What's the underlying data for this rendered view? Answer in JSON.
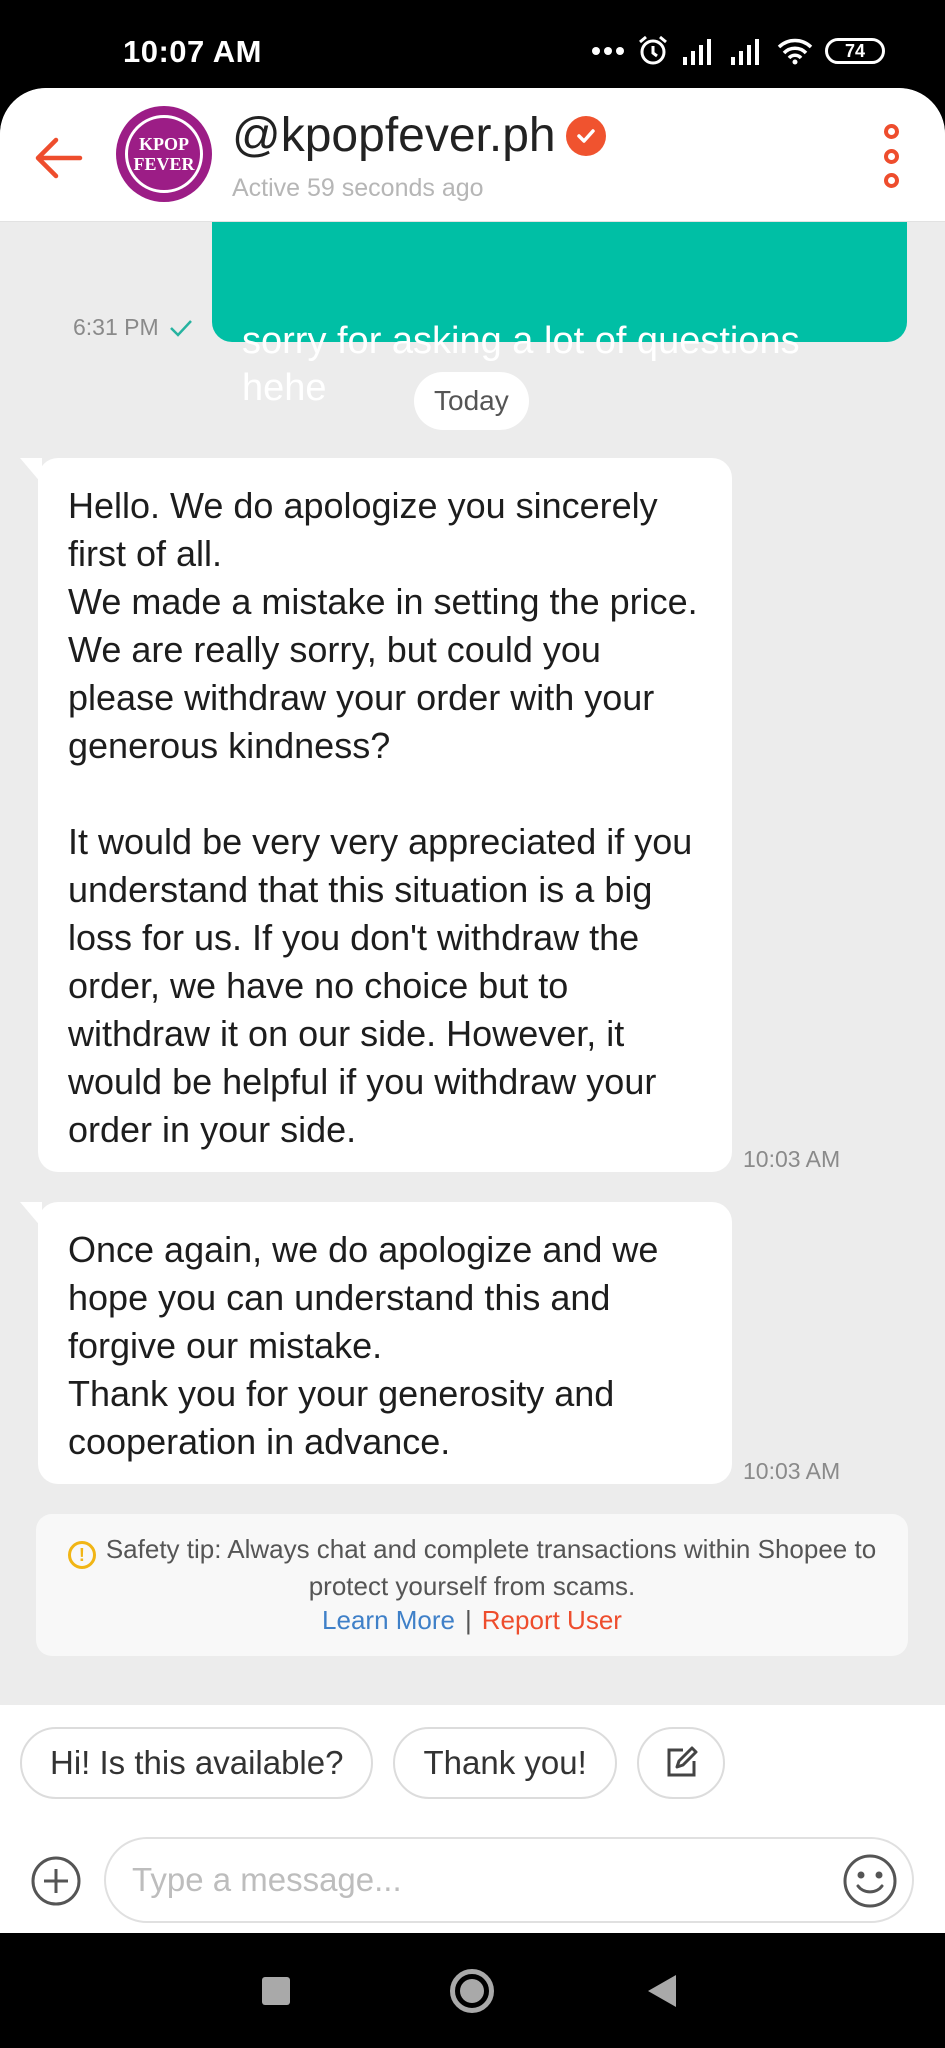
{
  "status_bar": {
    "time": "10:07 AM",
    "battery": "74"
  },
  "header": {
    "shop_name": "@kpopfever.ph",
    "active_status": "Active 59 seconds ago",
    "avatar_line1": "KPOP",
    "avatar_line2": "FEVER"
  },
  "messages": {
    "outgoing": {
      "text": "sorry for asking a lot of questions hehe",
      "time": "6:31 PM"
    },
    "date_divider": "Today",
    "incoming": [
      {
        "text": "Hello. We do apologize you sincerely first of all.\nWe made a mistake in setting the price. We are really sorry, but could you please withdraw your order with your generous kindness?\n\nIt would be very very appreciated if you understand that this situation is a big loss for us. If you don't withdraw the order, we have no choice but to withdraw it on our side. However, it would be helpful if you withdraw your order in your side.",
        "time": "10:03 AM"
      },
      {
        "text": "Once again, we do apologize and we hope you can understand this and forgive our mistake.\nThank you for your generosity and cooperation in advance.",
        "time": "10:03 AM"
      }
    ]
  },
  "safety_tip": {
    "text": "Safety tip: Always chat and complete transactions within Shopee to protect yourself from scams.",
    "learn_more": "Learn More",
    "separator": "|",
    "report_user": "Report User"
  },
  "quick_replies": [
    "Hi! Is this available?",
    "Thank you!"
  ],
  "composer": {
    "placeholder": "Type a message..."
  },
  "colors": {
    "brand": "#ee4d2d",
    "outgoing_bubble": "#00bfa5",
    "link": "#3f80c8"
  }
}
